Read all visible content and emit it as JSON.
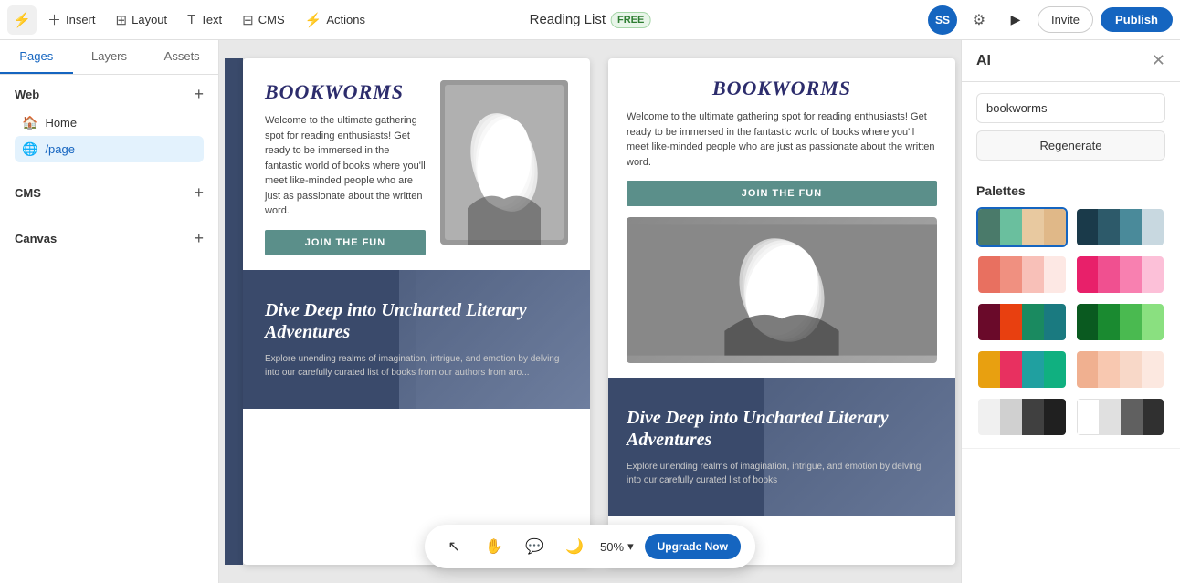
{
  "toolbar": {
    "logo_label": "≡",
    "insert_label": "Insert",
    "layout_label": "Layout",
    "text_label": "Text",
    "cms_label": "CMS",
    "actions_label": "Actions",
    "site_name": "Reading List",
    "free_badge": "FREE",
    "avatar": "SS",
    "invite_label": "Invite",
    "publish_label": "Publish"
  },
  "sidebar": {
    "tabs": [
      "Pages",
      "Layers",
      "Assets"
    ],
    "active_tab": "Pages",
    "web_section": "Web",
    "cms_section": "CMS",
    "canvas_section": "Canvas",
    "nav_items": [
      {
        "icon": "🏠",
        "label": "Home",
        "active": false
      },
      {
        "icon": "🌐",
        "label": "/page",
        "active": true
      }
    ]
  },
  "canvas": {
    "left_preview": {
      "title": "BOOKWORMS",
      "description": "Welcome to the ultimate gathering spot for reading enthusiasts! Get ready to be immersed in the fantastic world of books where you'll meet like-minded people who are just as passionate about the written word.",
      "cta": "JOIN THE FUN",
      "banner_title": "Dive Deep into Uncharted Literary Adventures",
      "banner_desc": "Explore unending realms of imagination, intrigue, and emotion by delving into our carefully curated list of books from our authors from aro..."
    },
    "right_preview": {
      "title": "BOOKWORMS",
      "description": "Welcome to the ultimate gathering spot for reading enthusiasts! Get ready to be immersed in the fantastic world of books where you'll meet like-minded people who are just as passionate about the written word.",
      "cta": "JOIN THE FUN",
      "banner_title": "Dive Deep into Uncharted Literary Adventures",
      "banner_desc": "Explore unending realms of imagination, intrigue, and emotion by delving into our carefully curated list of books"
    }
  },
  "bottom_toolbar": {
    "zoom": "50%",
    "upgrade_label": "Upgrade Now"
  },
  "right_panel": {
    "title": "AI",
    "ai_input": "bookworms",
    "regenerate_label": "Regenerate",
    "palettes_title": "Palettes",
    "palettes": [
      {
        "id": 1,
        "colors": [
          "#4a7a6a",
          "#6abf9e",
          "#e8c9a0",
          "#e8c9a0"
        ],
        "selected": true
      },
      {
        "id": 2,
        "colors": [
          "#1a3a4a",
          "#2d5a6a",
          "#4a8a9a",
          "#c8d8e0"
        ]
      },
      {
        "id": 3,
        "colors": [
          "#e87060",
          "#f09080",
          "#f8c0b8",
          "#fde8e4"
        ]
      },
      {
        "id": 4,
        "colors": [
          "#e8206a",
          "#f05090",
          "#f880b0",
          "#fcc0d8"
        ]
      },
      {
        "id": 5,
        "colors": [
          "#6a0a2a",
          "#e84010",
          "#1a8a60",
          "#1a7a80"
        ]
      },
      {
        "id": 6,
        "colors": [
          "#0a5a20",
          "#1a8a30",
          "#4aba50",
          "#8ae080"
        ]
      },
      {
        "id": 7,
        "colors": [
          "#e8a010",
          "#e83060",
          "#20a0a0",
          "#20a0a0"
        ]
      },
      {
        "id": 8,
        "colors": [
          "#f0b090",
          "#f8c8b0",
          "#f8d8c8",
          "#fce8e0"
        ]
      },
      {
        "id": 9,
        "colors": [
          "#f0f0f0",
          "#d0d0d0",
          "#404040",
          "#202020"
        ]
      },
      {
        "id": 10,
        "colors": [
          "#ffffff",
          "#f0f0f0",
          "#606060",
          "#303030"
        ]
      }
    ]
  }
}
